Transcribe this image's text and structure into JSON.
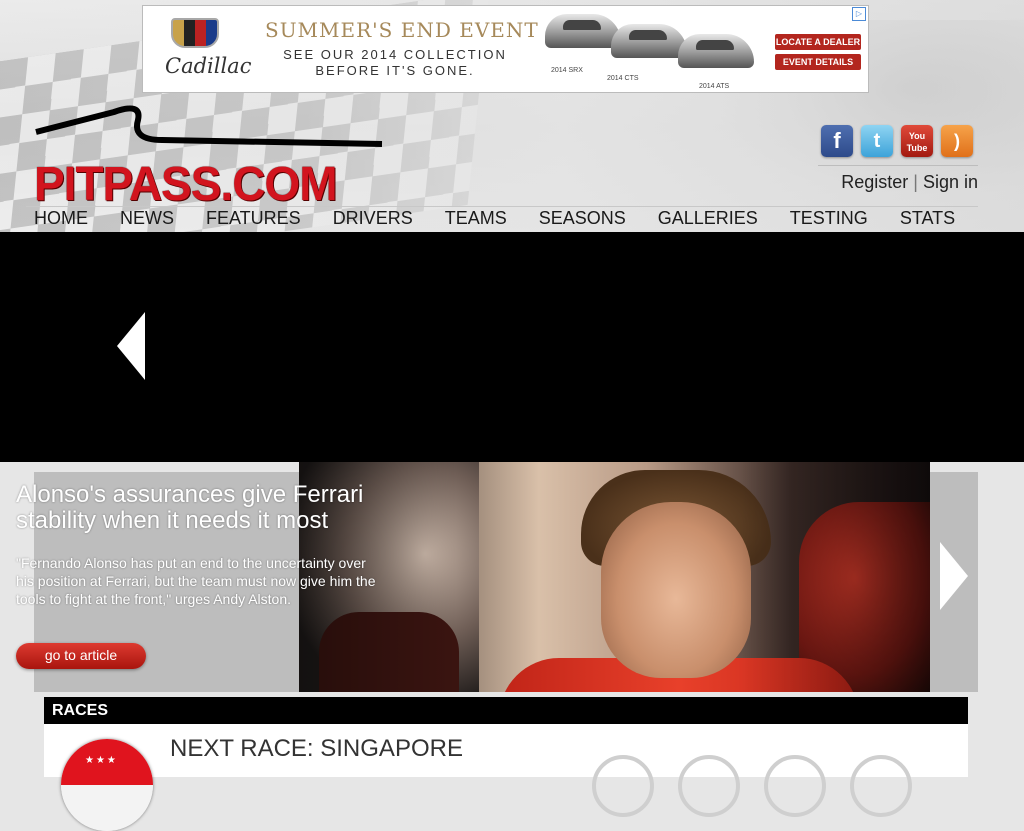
{
  "ad": {
    "brand": "Cadillac",
    "headline": "SUMMER'S END EVENT",
    "subline_1": "SEE OUR 2014 COLLECTION",
    "subline_2": "BEFORE IT'S GONE.",
    "car_labels": [
      "2014 SRX",
      "2014 CTS",
      "2014 ATS"
    ],
    "buttons": [
      "LOCATE A DEALER",
      "EVENT DETAILS"
    ],
    "adchoices_icon": "adchoices-icon"
  },
  "site": {
    "logo_text": "PITPASS.COM"
  },
  "social": [
    {
      "name": "facebook",
      "glyph": "f"
    },
    {
      "name": "twitter",
      "glyph": "t"
    },
    {
      "name": "youtube",
      "glyph": "You Tube"
    },
    {
      "name": "rss",
      "glyph": ")"
    }
  ],
  "account": {
    "register": "Register",
    "separator": "|",
    "signin": "Sign in"
  },
  "nav": [
    "HOME",
    "NEWS",
    "FEATURES",
    "DRIVERS",
    "TEAMS",
    "SEASONS",
    "GALLERIES",
    "TESTING",
    "STATS"
  ],
  "slide": {
    "title": "Alonso's assurances give Ferrari stability when it needs it most",
    "excerpt": "\"Fernando Alonso has put an end to the uncertainty over his position at Ferrari, but the team must now give him the tools to fight at the front,\" urges Andy Alston.",
    "cta": "go to article",
    "prev_icon": "arrow-left-icon",
    "next_icon": "arrow-right-icon"
  },
  "races": {
    "section_title": "RACES",
    "next_race": "NEXT RACE: SINGAPORE"
  }
}
